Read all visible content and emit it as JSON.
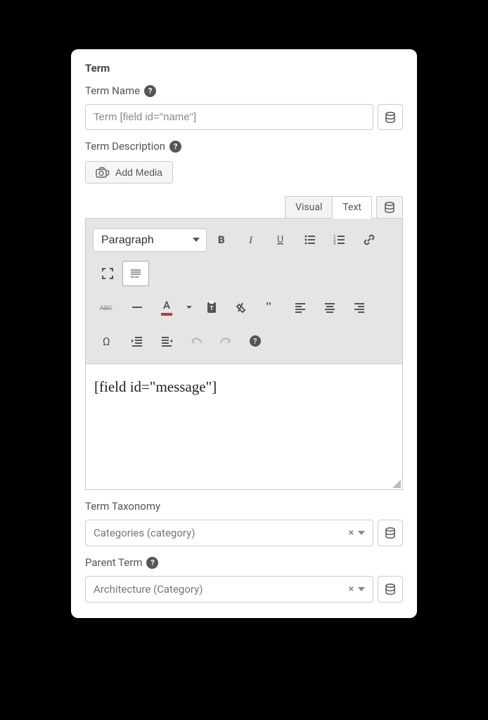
{
  "section": {
    "title": "Term"
  },
  "termName": {
    "label": "Term Name",
    "value": "Term [field id=\"name\"]"
  },
  "termDescription": {
    "label": "Term Description",
    "addMedia": "Add Media"
  },
  "editor": {
    "tabs": {
      "visual": "Visual",
      "text": "Text"
    },
    "formatSelect": "Paragraph",
    "content": "[field id=\"message\"]"
  },
  "termTaxonomy": {
    "label": "Term Taxonomy",
    "value": "Categories (category)"
  },
  "parentTerm": {
    "label": "Parent Term",
    "value": "Architecture (Category)"
  }
}
